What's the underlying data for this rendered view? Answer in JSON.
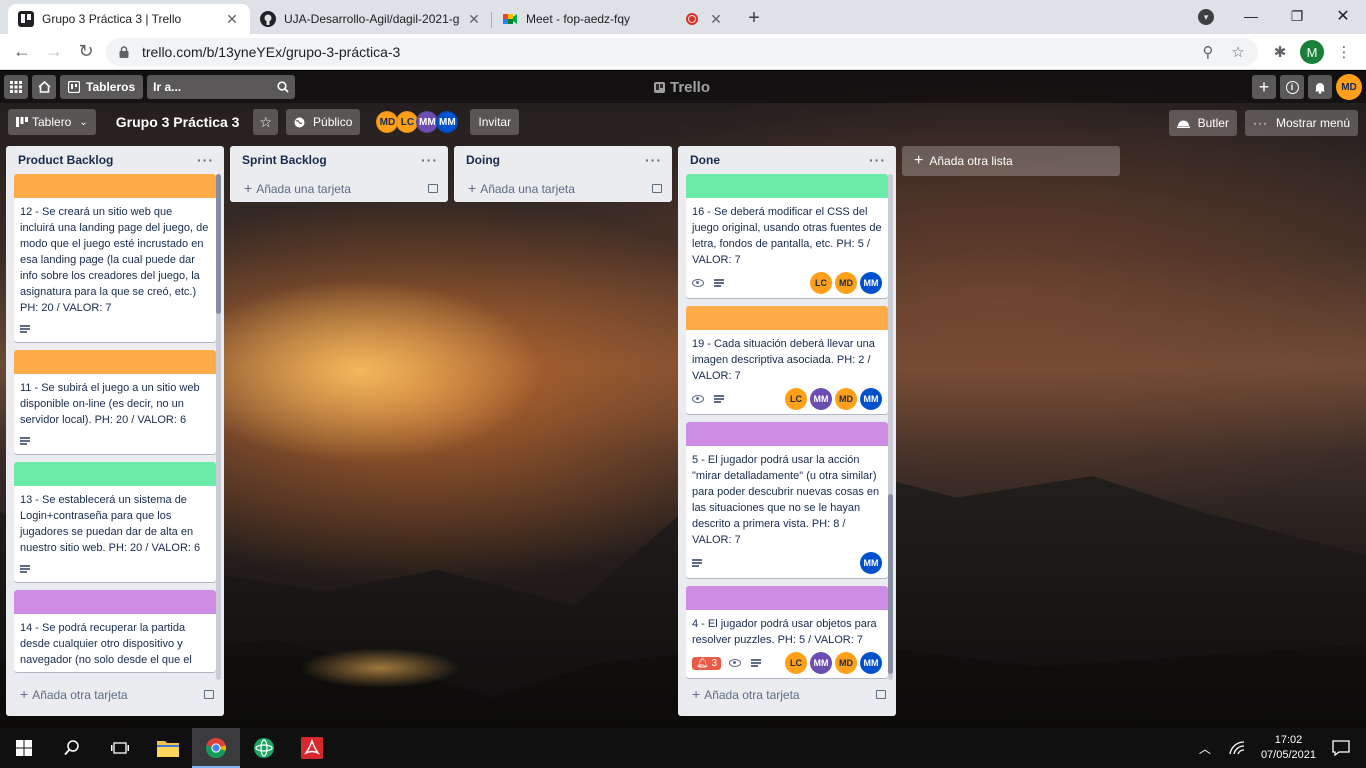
{
  "browser": {
    "tabs": [
      {
        "title": "Grupo 3 Práctica 3 | Trello",
        "active": true
      },
      {
        "title": "UJA-Desarrollo-Agil/dagil-2021-g",
        "active": false
      },
      {
        "title": "Meet - fop-aedz-fqy",
        "active": false
      }
    ],
    "url": "trello.com/b/13yneYEx/grupo-3-práctica-3",
    "profile_initial": "M"
  },
  "trello": {
    "boards_label": "Tableros",
    "search_label": "Ir a...",
    "logo": "Trello",
    "user_initials": "MD",
    "board": {
      "view_label": "Tablero",
      "title": "Grupo 3 Práctica 3",
      "visibility": "Público",
      "members": [
        "MD",
        "LC",
        "MM",
        "MM"
      ],
      "invite_label": "Invitar",
      "butler_label": "Butler",
      "menu_label": "Mostrar menú"
    },
    "add_list_label": "Añada otra lista",
    "lists": [
      {
        "name": "Product Backlog",
        "add_label": "Añada otra tarjeta",
        "cards": [
          {
            "cover": "#ffab4a",
            "text": "12 - Se creará un sitio web que incluirá una landing page del juego, de modo que el juego esté incrustado en esa landing page (la cual puede dar info sobre los creadores del juego, la asignatura para la que se creó, etc.) PH: 20 / VALOR: 7"
          },
          {
            "cover": "#ffab4a",
            "text": "11 - Se subirá el juego a un sitio web disponible on-line (es decir, no un servidor local). PH: 20 / VALOR: 6"
          },
          {
            "cover": "#6deca9",
            "text": "13 - Se establecerá un sistema de Login+contraseña para que los jugadores se puedan dar de alta en nuestro sitio web. PH: 20 / VALOR: 6"
          },
          {
            "cover": "#cd8de5",
            "text": "14 - Se podrá recuperar la partida desde cualquier otro dispositivo y navegador (no solo desde el que el"
          }
        ]
      },
      {
        "name": "Sprint Backlog",
        "add_label": "Añada una tarjeta",
        "cards": []
      },
      {
        "name": "Doing",
        "add_label": "Añada una tarjeta",
        "cards": []
      },
      {
        "name": "Done",
        "add_label": "Añada otra tarjeta",
        "cards": [
          {
            "cover": "#6deca9",
            "text": "16 - Se deberá modificar el CSS del juego original, usando otras fuentes de letra, fondos de pantalla, etc. PH: 5 / VALOR: 7",
            "members": [
              "LC",
              "MD",
              "MM"
            ]
          },
          {
            "cover": "#ffab4a",
            "text": "19 - Cada situación deberá llevar una imagen descriptiva asociada. PH: 2 / VALOR: 7",
            "members": [
              "LC",
              "MM",
              "MD",
              "MM"
            ]
          },
          {
            "cover": "#cd8de5",
            "text": "5 - El jugador podrá usar la acción \"mirar detalladamente\" (u otra similar) para poder descubrir nuevas cosas en las situaciones que no se le hayan descrito a primera vista. PH: 8 / VALOR: 7",
            "members": [
              "MM"
            ]
          },
          {
            "cover": "#cd8de5",
            "text": "4 - El jugador podrá usar objetos para resolver puzzles. PH: 5 / VALOR: 7",
            "notifications": "3",
            "members": [
              "LC",
              "MM",
              "MD",
              "MM"
            ]
          }
        ]
      }
    ]
  },
  "taskbar": {
    "time": "17:02",
    "date": "07/05/2021"
  }
}
